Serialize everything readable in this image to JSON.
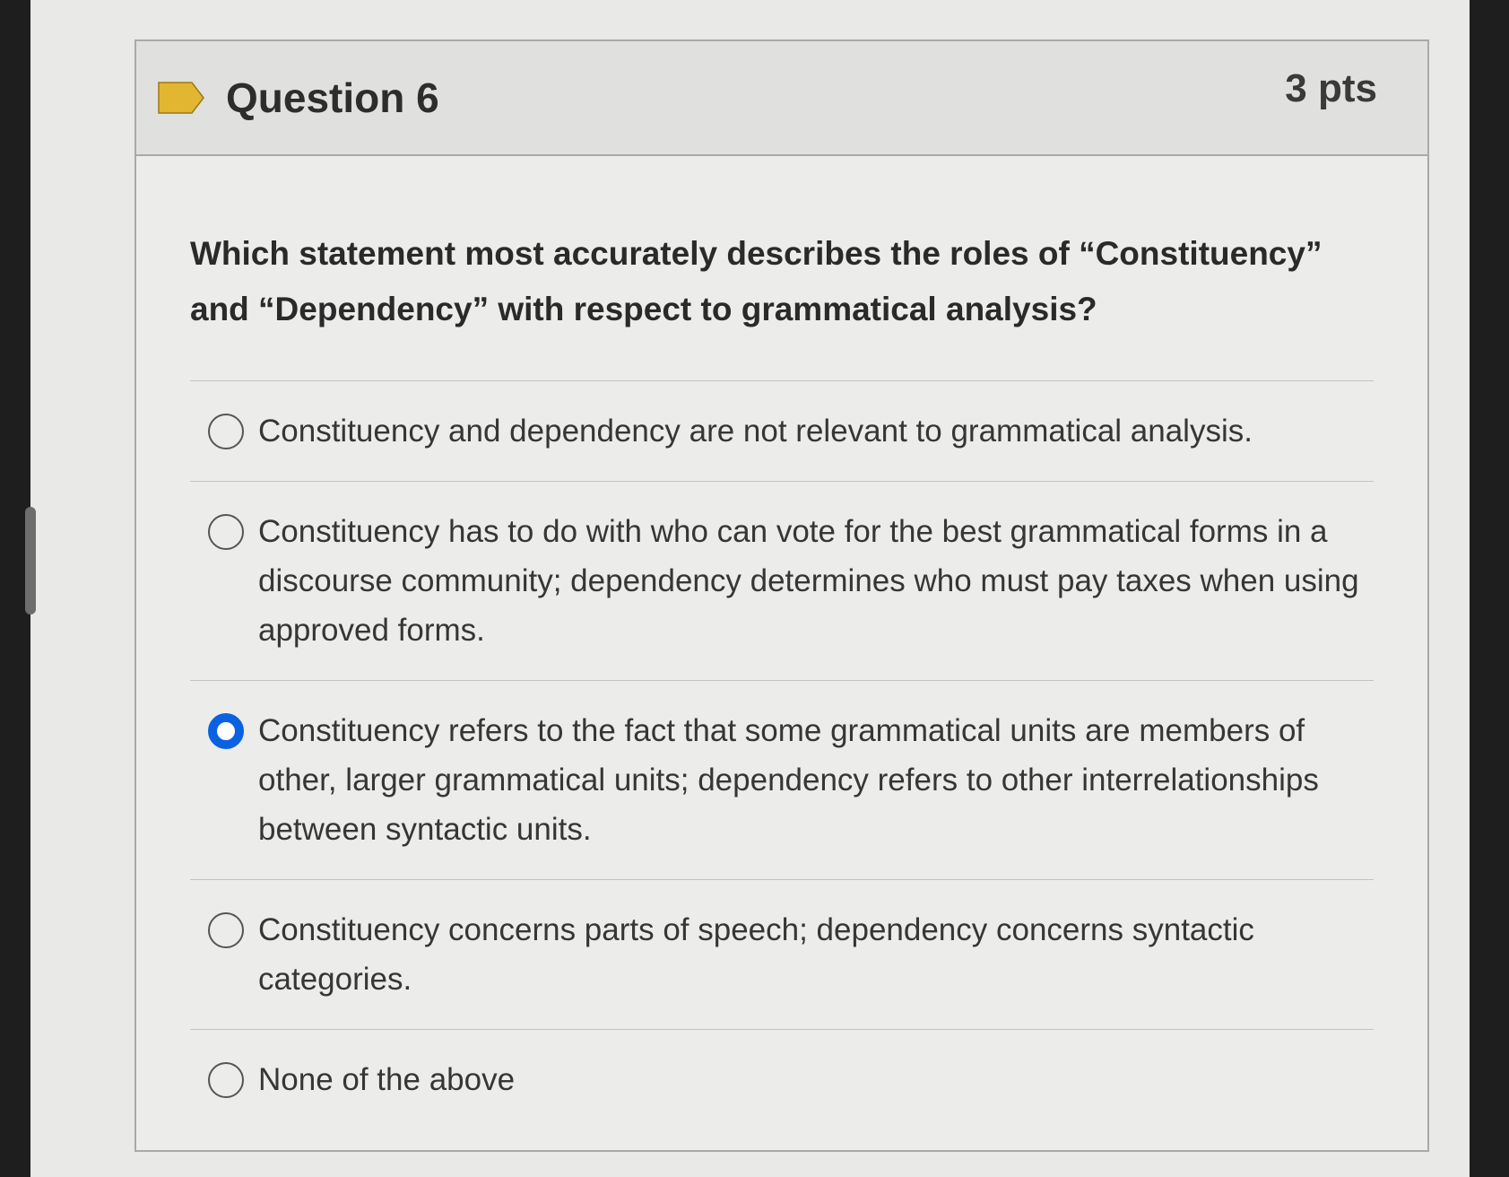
{
  "question": {
    "title": "Question 6",
    "points": "3 pts",
    "text": "Which statement most accurately describes the roles of “Constituency” and “Dependency” with respect to grammatical analysis?"
  },
  "options": [
    {
      "label": "Constituency and dependency are not relevant to grammatical analysis.",
      "selected": false
    },
    {
      "label": "Constituency has to do with who can vote for the best grammatical forms in a discourse community; dependency determines who must pay taxes when using approved forms.",
      "selected": false
    },
    {
      "label": "Constituency refers to the fact that some grammatical units are members of other, larger grammatical units; dependency refers to other interrelationships between syntactic units.",
      "selected": true
    },
    {
      "label": "Constituency concerns parts of speech; dependency concerns syntactic categories.",
      "selected": false
    },
    {
      "label": "None of the above",
      "selected": false
    }
  ],
  "colors": {
    "flag": "#e2b630",
    "radio_selected": "#0a62e0"
  }
}
